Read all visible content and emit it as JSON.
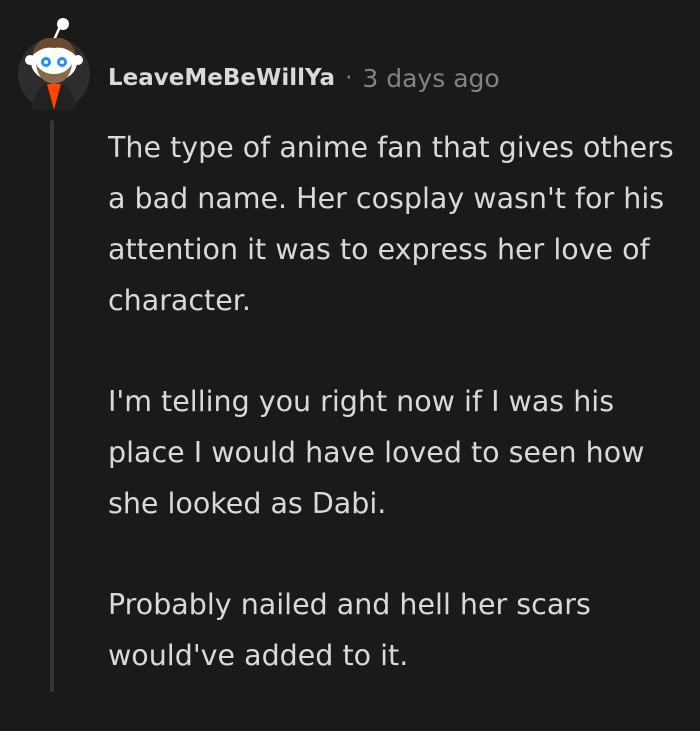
{
  "comment": {
    "username": "LeaveMeBeWillYa",
    "separator": "·",
    "timestamp": "3 days ago",
    "avatar_icon": "reddit-snoo-avatar-icon",
    "paragraphs": [
      "The type of anime fan that gives others a bad name. Her cosplay wasn't for his attention it was to express her love of character.",
      "I'm telling you right now if I was his place I would have loved to seen how she looked as Dabi.",
      "Probably nailed and hell her scars would've added to it."
    ]
  },
  "colors": {
    "background": "#1a1a1b",
    "text": "#d7dadc",
    "meta": "#818384",
    "thread_line": "#343536",
    "avatar_circle": "#2d2d2f",
    "avatar_accent": "#ff4500"
  }
}
